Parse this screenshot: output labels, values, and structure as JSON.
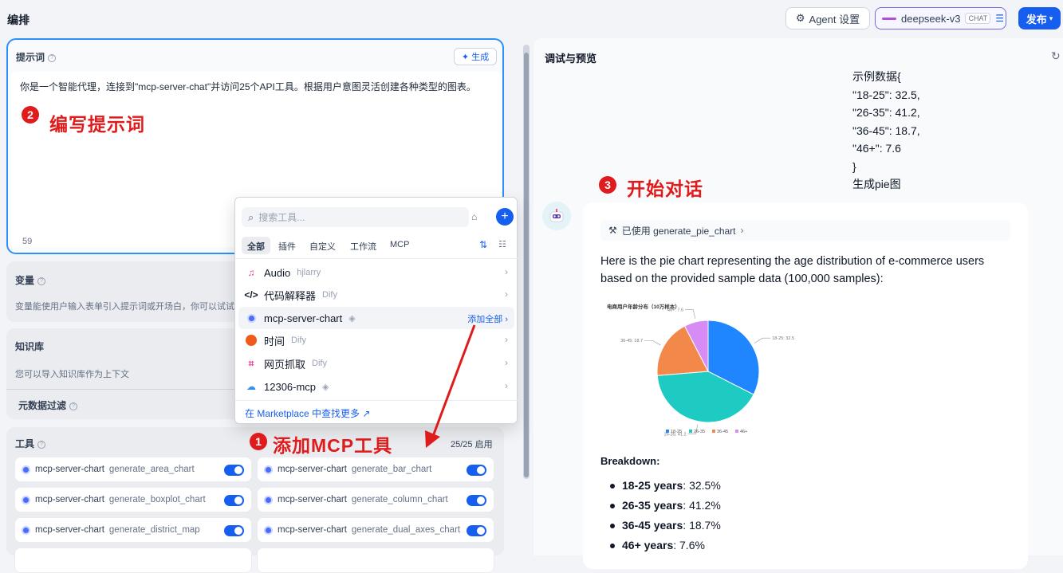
{
  "header": {
    "title": "编排",
    "agent_settings": "Agent 设置",
    "model_name": "deepseek-v3",
    "model_badge": "CHAT",
    "publish": "发布"
  },
  "prompt": {
    "title": "提示词",
    "generate": "生成",
    "text": "你是一个智能代理，连接到\"mcp-server-chat\"并访问25个API工具。根据用户意图灵活创建各种类型的图表。",
    "char_count": "59"
  },
  "variables": {
    "title": "变量",
    "desc": "变量能使用户输入表单引入提示词或开场白，你可以试试在"
  },
  "knowledge": {
    "title": "知识库",
    "desc": "您可以导入知识库作为上下文",
    "metadata_filter": "元数据过滤"
  },
  "tools": {
    "title": "工具",
    "count": "25/25 启用",
    "items": [
      {
        "server": "mcp-server-chart",
        "name": "generate_area_chart"
      },
      {
        "server": "mcp-server-chart",
        "name": "generate_bar_chart"
      },
      {
        "server": "mcp-server-chart",
        "name": "generate_boxplot_chart"
      },
      {
        "server": "mcp-server-chart",
        "name": "generate_column_chart"
      },
      {
        "server": "mcp-server-chart",
        "name": "generate_district_map"
      },
      {
        "server": "mcp-server-chart",
        "name": "generate_dual_axes_chart"
      }
    ]
  },
  "tool_popup": {
    "search_placeholder": "搜索工具...",
    "tabs": [
      "全部",
      "插件",
      "自定义",
      "工作流",
      "MCP"
    ],
    "items": [
      {
        "name": "Audio",
        "source": "hjlarry"
      },
      {
        "name": "代码解释器",
        "source": "Dify"
      },
      {
        "name": "mcp-server-chart",
        "source": "",
        "action": "添加全部"
      },
      {
        "name": "时间",
        "source": "Dify"
      },
      {
        "name": "网页抓取",
        "source": "Dify"
      },
      {
        "name": "12306-mcp",
        "source": ""
      }
    ],
    "marketplace_link": "在 Marketplace 中查找更多 ↗"
  },
  "annotations": {
    "step1_num": "1",
    "step1_text": "添加MCP工具",
    "step2_num": "2",
    "step2_text": "编写提示词",
    "step3_num": "3",
    "step3_text": "开始对话"
  },
  "debug": {
    "title": "调试与预览",
    "user_message": "示例数据{\n\"18-25\": 32.5,\n\"26-35\": 41.2,\n\"36-45\": 18.7,\n\"46+\": 7.6\n}\n生成pie图",
    "tool_used": "已使用 generate_pie_chart",
    "reply": "Here is the pie chart representing the age distribution of e-commerce users based on the provided sample data (100,000 samples):",
    "breakdown_title": "Breakdown:",
    "breakdown": [
      {
        "label": "18-25 years",
        "value": ": 32.5%"
      },
      {
        "label": "26-35 years",
        "value": ": 41.2%"
      },
      {
        "label": "36-45 years",
        "value": ": 18.7%"
      },
      {
        "label": "46+ years",
        "value": ": 7.6%"
      }
    ]
  },
  "chart_data": {
    "type": "pie",
    "title": "电商用户年龄分布（10万样本）",
    "categories": [
      "18-25",
      "26-35",
      "36-45",
      "46+"
    ],
    "values": [
      32.5,
      41.2,
      18.7,
      7.6
    ],
    "slice_labels": [
      "18-25: 32.5",
      "26-35: 41.2",
      "36-45: 18.7",
      "46+: 7.6"
    ],
    "colors": [
      "#1f86ff",
      "#1ecbc3",
      "#f2894a",
      "#d78bf5"
    ],
    "legend_position": "bottom"
  }
}
